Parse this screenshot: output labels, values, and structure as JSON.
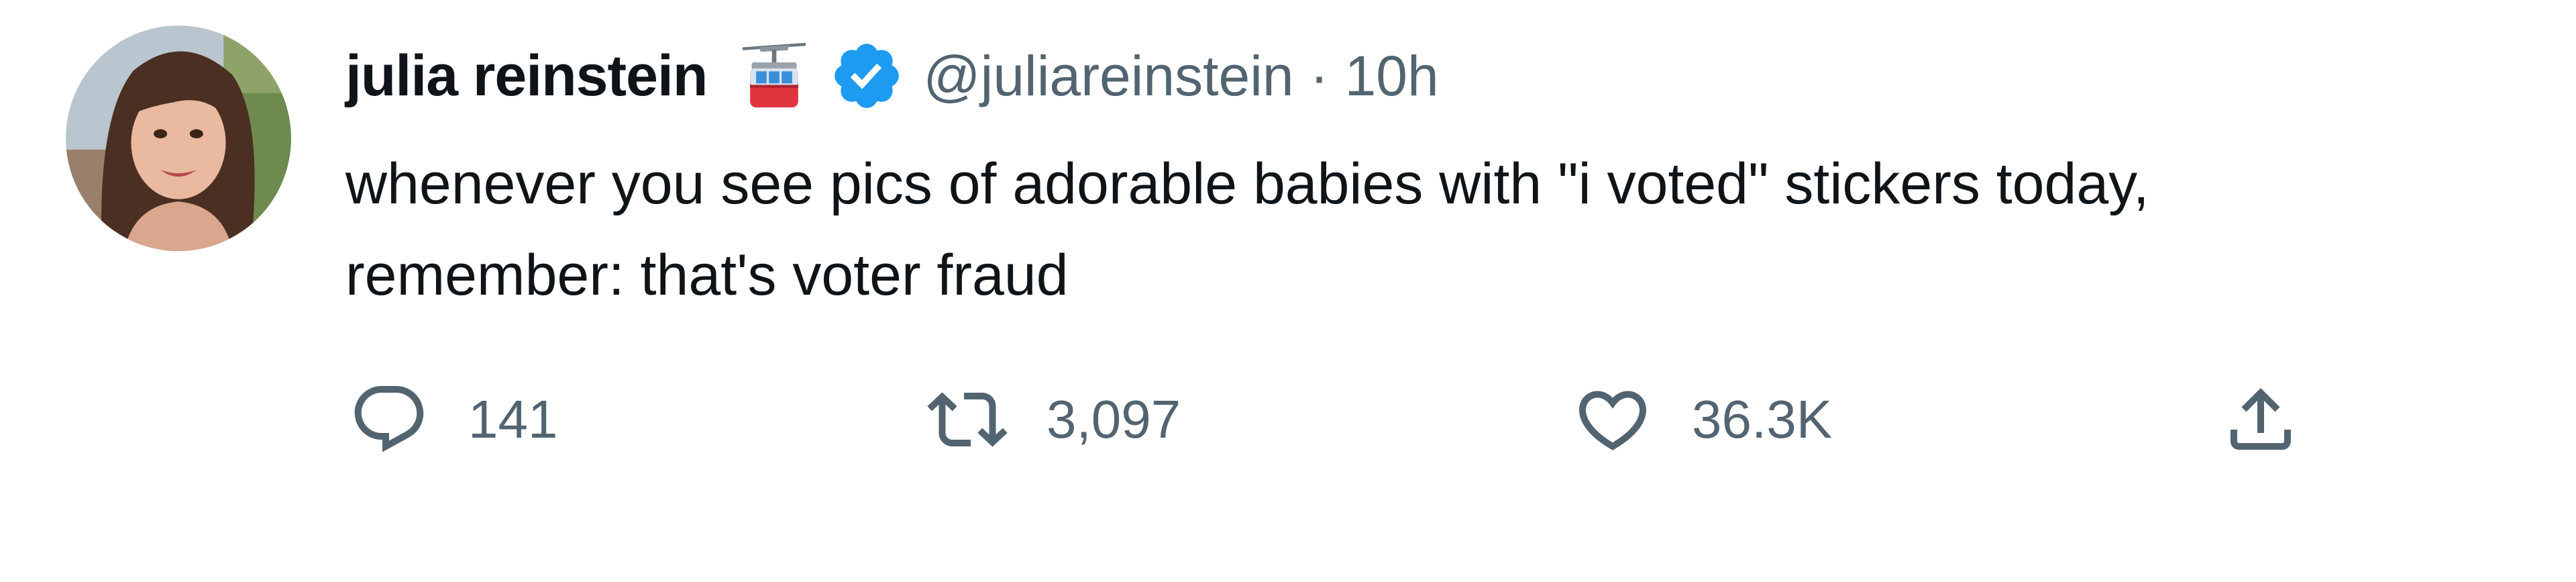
{
  "tweet": {
    "author": {
      "display_name": "julia reinstein",
      "name_emoji": "aerial-tramway-icon",
      "verified": true,
      "handle": "@juliareinstein",
      "separator": "·",
      "time": "10h"
    },
    "text_lines": [
      "whenever you see pics of adorable babies with \"i voted\" stickers today,",
      "remember: that's voter fraud"
    ],
    "actions": {
      "reply_count": "141",
      "retweet_count": "3,097",
      "like_count": "36.3K"
    },
    "colors": {
      "text": "#0f1419",
      "muted": "#536471",
      "verified_blue": "#1d9bf0"
    }
  }
}
